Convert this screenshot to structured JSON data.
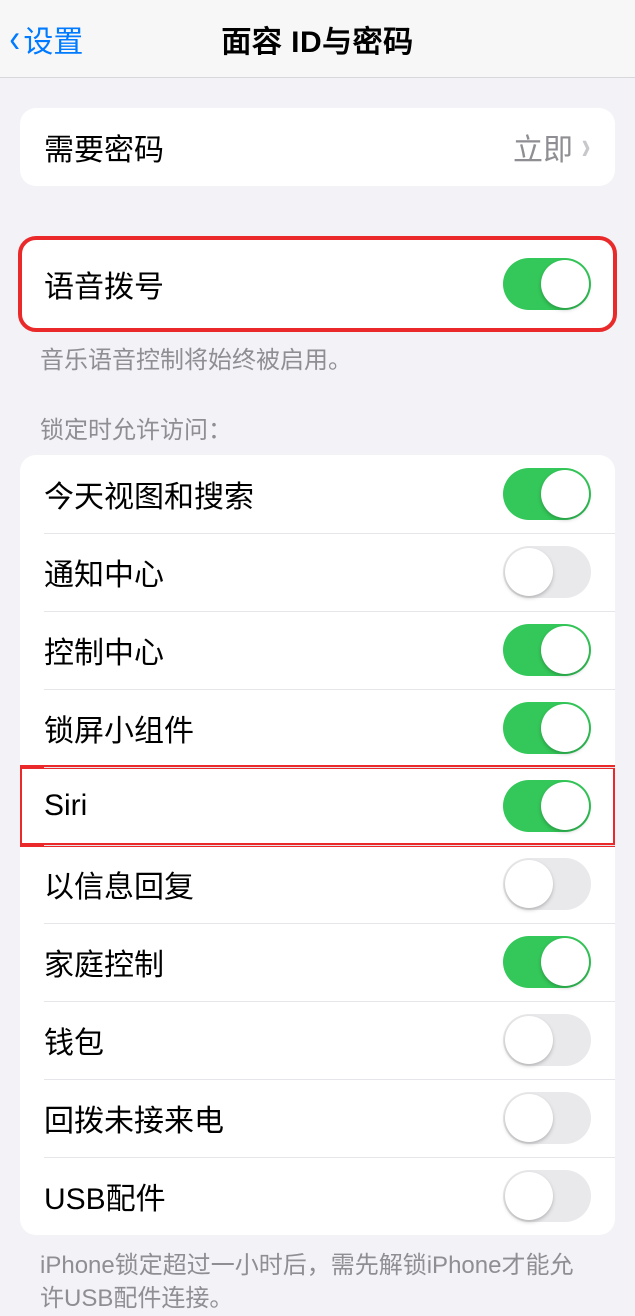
{
  "nav": {
    "back_label": "设置",
    "title": "面容 ID与密码"
  },
  "passcode_group": {
    "require_passcode_label": "需要密码",
    "require_passcode_value": "立即"
  },
  "voice_dial": {
    "label": "语音拨号",
    "on": true,
    "footer": "音乐语音控制将始终被启用。"
  },
  "lock_access": {
    "header": "锁定时允许访问：",
    "items": [
      {
        "label": "今天视图和搜索",
        "on": true,
        "name": "today-search"
      },
      {
        "label": "通知中心",
        "on": false,
        "name": "notification-center"
      },
      {
        "label": "控制中心",
        "on": true,
        "name": "control-center"
      },
      {
        "label": "锁屏小组件",
        "on": true,
        "name": "lock-widgets"
      },
      {
        "label": "Siri",
        "on": true,
        "name": "siri",
        "highlight": true
      },
      {
        "label": "以信息回复",
        "on": false,
        "name": "reply-message"
      },
      {
        "label": "家庭控制",
        "on": true,
        "name": "home-control"
      },
      {
        "label": "钱包",
        "on": false,
        "name": "wallet"
      },
      {
        "label": "回拨未接来电",
        "on": false,
        "name": "return-missed-call"
      },
      {
        "label": "USB配件",
        "on": false,
        "name": "usb-accessories"
      }
    ],
    "footer": "iPhone锁定超过一小时后，需先解锁iPhone才能允许USB配件连接。"
  }
}
